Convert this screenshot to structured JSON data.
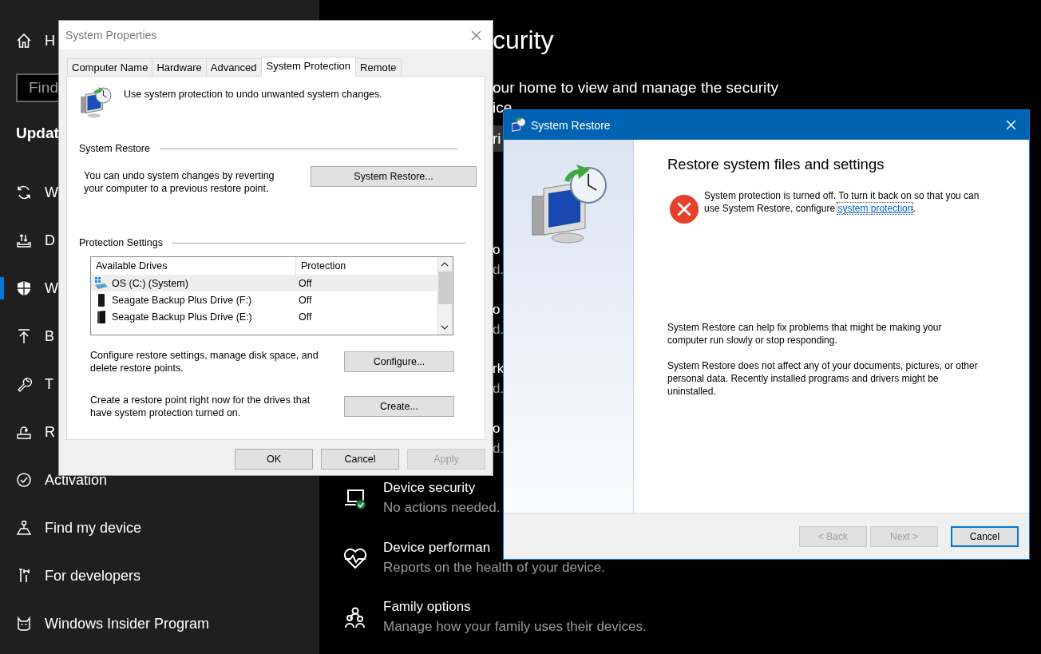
{
  "settings": {
    "sidebar": {
      "home_label": "H",
      "search": {
        "placeholder": "Find"
      },
      "section_title": "Updat",
      "items": [
        {
          "label": "W",
          "selected": false
        },
        {
          "label": "D",
          "selected": false
        },
        {
          "label": "W",
          "selected": true
        },
        {
          "label": "B",
          "selected": false
        },
        {
          "label": "T",
          "selected": false
        },
        {
          "label": "R",
          "selected": false
        },
        {
          "label": "Activation",
          "selected": false
        },
        {
          "label": "Find my device",
          "selected": false
        },
        {
          "label": "For developers",
          "selected": false
        },
        {
          "label": "Windows Insider Program",
          "selected": false
        }
      ]
    },
    "main": {
      "title": "curity",
      "intro_lines": [
        "our home to view and manage the security",
        "ice"
      ],
      "button_fragment": "ri",
      "areas": [
        {
          "kind": "partial",
          "title": "o",
          "subtitle": "d."
        },
        {
          "kind": "partial",
          "title": "o",
          "subtitle": "d."
        },
        {
          "kind": "partial",
          "title": "rk",
          "subtitle": "d."
        },
        {
          "kind": "partial",
          "title": "o",
          "subtitle": "d."
        },
        {
          "kind": "full",
          "title": "Device security",
          "subtitle": "No actions needed."
        },
        {
          "kind": "full",
          "title": "Device performan",
          "subtitle": "Reports on the health of your device."
        },
        {
          "kind": "full",
          "title": "Family options",
          "subtitle": "Manage how your family uses their devices."
        }
      ]
    }
  },
  "system_properties": {
    "title": "System Properties",
    "tabs": [
      {
        "label": "Computer Name",
        "selected": false
      },
      {
        "label": "Hardware",
        "selected": false
      },
      {
        "label": "Advanced",
        "selected": false
      },
      {
        "label": "System Protection",
        "selected": true
      },
      {
        "label": "Remote",
        "selected": false
      }
    ],
    "intro": "Use system protection to undo unwanted system changes.",
    "restore_section": {
      "heading": "System Restore",
      "text": "You can undo system changes by reverting your computer to a previous restore point.",
      "button": "System Restore..."
    },
    "protection_section": {
      "heading": "Protection Settings",
      "columns": [
        "Available Drives",
        "Protection"
      ],
      "drives": [
        {
          "kind": "system",
          "name": "OS (C:) (System)",
          "protection": "Off",
          "selected": true
        },
        {
          "kind": "portable",
          "name": "Seagate Backup Plus Drive (F:)",
          "protection": "Off",
          "selected": false
        },
        {
          "kind": "desktop",
          "name": "Seagate Backup Plus Drive (E:)",
          "protection": "Off",
          "selected": false
        }
      ],
      "configure": {
        "text": "Configure restore settings, manage disk space, and delete restore points.",
        "button": "Configure..."
      },
      "create": {
        "text": "Create a restore point right now for the drives that have system protection turned on.",
        "button": "Create..."
      }
    },
    "buttons": [
      {
        "label": "OK",
        "disabled": false
      },
      {
        "label": "Cancel",
        "disabled": false
      },
      {
        "label": "Apply",
        "disabled": true
      }
    ]
  },
  "system_restore": {
    "title": "System Restore",
    "heading": "Restore system files and settings",
    "error": {
      "before": "System protection is turned off. To turn it back on so that you can use System Restore, configure ",
      "link": "system protection",
      "after": "."
    },
    "paragraphs": [
      "System Restore can help fix problems that might be making your computer run slowly or stop responding.",
      "System Restore does not affect any of your documents, pictures, or other personal data. Recently installed programs and drivers might be uninstalled."
    ],
    "buttons": [
      {
        "label": "< Back",
        "disabled": true,
        "default": false
      },
      {
        "label": "Next >",
        "disabled": true,
        "default": false
      },
      {
        "label": "Cancel",
        "disabled": false,
        "default": true
      }
    ]
  }
}
